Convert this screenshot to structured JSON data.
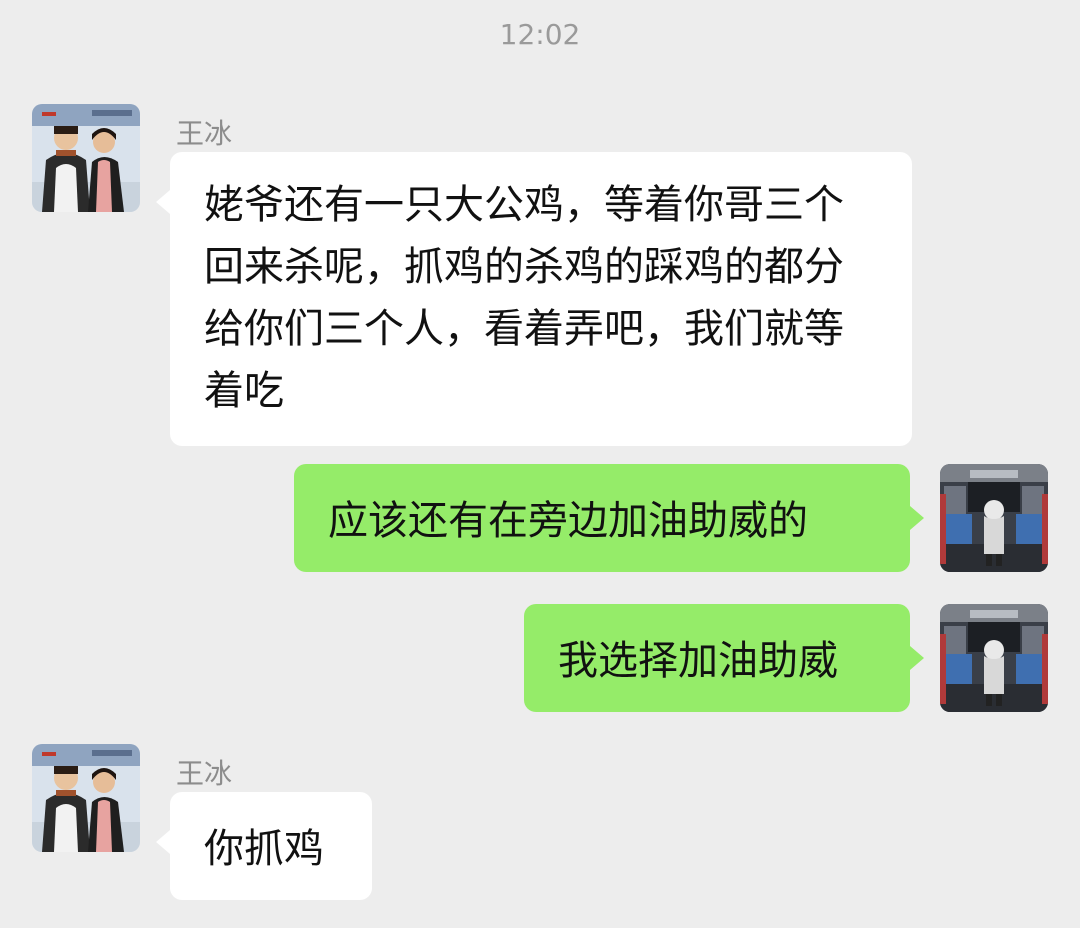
{
  "chat": {
    "timestamp": "12:02",
    "messages": [
      {
        "sender": "王冰",
        "direction": "incoming",
        "text": "姥爷还有一只大公鸡，等着你哥三个回来杀呢，抓鸡的杀鸡的踩鸡的都分给你们三个人，看着弄吧，我们就等着吃"
      },
      {
        "direction": "outgoing",
        "text": "应该还有在旁边加油助威的"
      },
      {
        "direction": "outgoing",
        "text": "我选择加油助威"
      },
      {
        "sender": "王冰",
        "direction": "incoming",
        "text": "你抓鸡"
      }
    ]
  },
  "colors": {
    "background": "#ededed",
    "incoming_bubble": "#ffffff",
    "outgoing_bubble": "#95ec69",
    "name_text": "#8c8c8c"
  }
}
